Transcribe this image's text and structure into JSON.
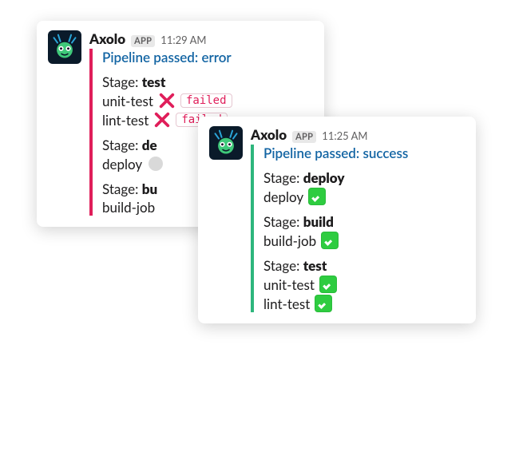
{
  "botName": "Axolo",
  "appBadge": "APP",
  "stageWord": "Stage:",
  "cards": {
    "a": {
      "time": "11:29 AM",
      "title": "Pipeline passed: error",
      "stages": [
        {
          "name": "test",
          "jobs": [
            {
              "name": "unit-test",
              "icon": "cross",
              "status": "failed"
            },
            {
              "name": "lint-test",
              "icon": "cross",
              "status": "failed"
            }
          ]
        },
        {
          "name": "de",
          "jobs": [
            {
              "name": "deploy",
              "icon": "gray"
            }
          ]
        },
        {
          "name": "bu",
          "jobs": [
            {
              "name": "build-job",
              "icon": "none"
            }
          ]
        }
      ]
    },
    "b": {
      "time": "11:25 AM",
      "title": "Pipeline passed: success",
      "stages": [
        {
          "name": "deploy",
          "jobs": [
            {
              "name": "deploy",
              "icon": "check"
            }
          ]
        },
        {
          "name": "build",
          "jobs": [
            {
              "name": "build-job",
              "icon": "check"
            }
          ]
        },
        {
          "name": "test",
          "jobs": [
            {
              "name": "unit-test",
              "icon": "check"
            },
            {
              "name": "lint-test",
              "icon": "check"
            }
          ]
        }
      ]
    }
  }
}
